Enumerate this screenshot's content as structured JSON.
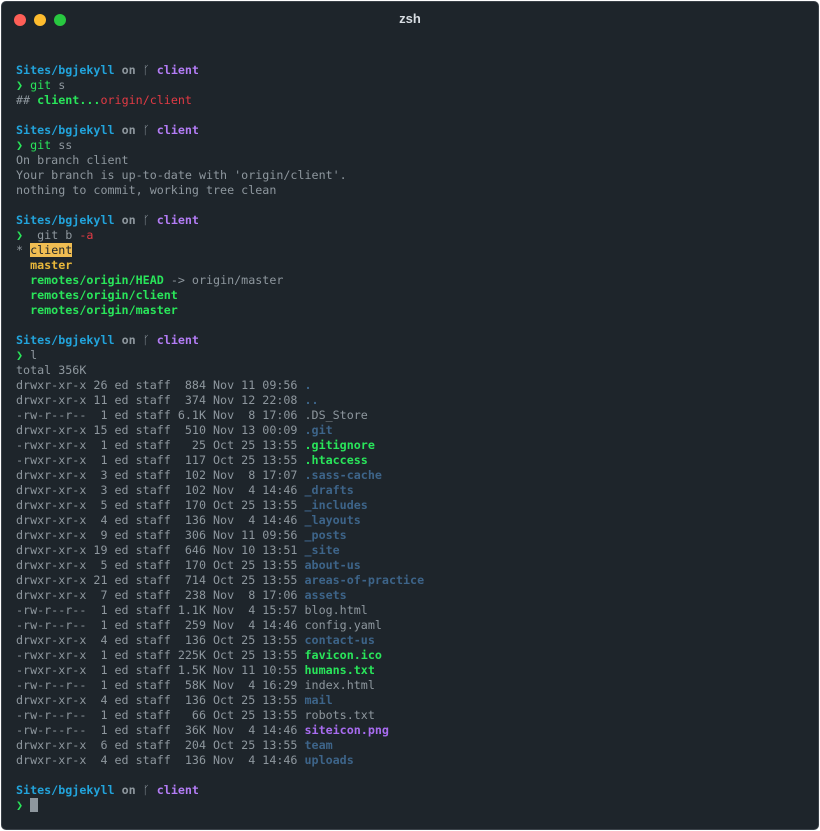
{
  "window": {
    "title": "zsh"
  },
  "prompt": {
    "dir": "Sites/bgjekyll",
    "on": "on",
    "branch": "client",
    "arrow": "❯",
    "branch_glyph": "ᚴ"
  },
  "blocks": [
    {
      "cmd": "git",
      "args": " s",
      "output": [
        {
          "pre": "## ",
          "a": "client...",
          "b": "origin/client"
        }
      ]
    },
    {
      "cmd": "git",
      "args": " ss",
      "output": [
        "On branch client",
        "Your branch is up-to-date with 'origin/client'.",
        "nothing to commit, working tree clean"
      ]
    },
    {
      "cmd": "git",
      "args": " b ",
      "flag": "-a",
      "branches": {
        "star": "* ",
        "current": "client",
        "master": "  master",
        "head": "  remotes/origin/HEAD",
        "head_target": " -> origin/master",
        "rclient": "  remotes/origin/client",
        "rmaster": "  remotes/origin/master"
      }
    },
    {
      "cmd": "l",
      "total": "total 356K"
    }
  ],
  "listing": [
    {
      "meta": "drwxr-xr-x 26 ed staff  884 Nov 11 09:56 ",
      "name": "."
    },
    {
      "meta": "drwxr-xr-x 11 ed staff  374 Nov 12 22:08 ",
      "name": ".."
    },
    {
      "meta": "-rw-r--r--  1 ed staff 6.1K Nov  8 17:06 ",
      "name": ".DS_Store"
    },
    {
      "meta": "drwxr-xr-x 15 ed staff  510 Nov 13 00:09 ",
      "name": ".git"
    },
    {
      "meta": "-rwxr-xr-x  1 ed staff   25 Oct 25 13:55 ",
      "name": ".gitignore"
    },
    {
      "meta": "-rwxr-xr-x  1 ed staff  117 Oct 25 13:55 ",
      "name": ".htaccess"
    },
    {
      "meta": "drwxr-xr-x  3 ed staff  102 Nov  8 17:07 ",
      "name": ".sass-cache"
    },
    {
      "meta": "drwxr-xr-x  3 ed staff  102 Nov  4 14:46 ",
      "name": "_drafts"
    },
    {
      "meta": "drwxr-xr-x  5 ed staff  170 Oct 25 13:55 ",
      "name": "_includes"
    },
    {
      "meta": "drwxr-xr-x  4 ed staff  136 Nov  4 14:46 ",
      "name": "_layouts"
    },
    {
      "meta": "drwxr-xr-x  9 ed staff  306 Nov 11 09:56 ",
      "name": "_posts"
    },
    {
      "meta": "drwxr-xr-x 19 ed staff  646 Nov 10 13:51 ",
      "name": "_site"
    },
    {
      "meta": "drwxr-xr-x  5 ed staff  170 Oct 25 13:55 ",
      "name": "about-us"
    },
    {
      "meta": "drwxr-xr-x 21 ed staff  714 Oct 25 13:55 ",
      "name": "areas-of-practice"
    },
    {
      "meta": "drwxr-xr-x  7 ed staff  238 Nov  8 17:06 ",
      "name": "assets"
    },
    {
      "meta": "-rw-r--r--  1 ed staff 1.1K Nov  4 15:57 ",
      "name": "blog.html"
    },
    {
      "meta": "-rw-r--r--  1 ed staff  259 Nov  4 14:46 ",
      "name": "config.yaml"
    },
    {
      "meta": "drwxr-xr-x  4 ed staff  136 Oct 25 13:55 ",
      "name": "contact-us"
    },
    {
      "meta": "-rwxr-xr-x  1 ed staff 225K Oct 25 13:55 ",
      "name": "favicon.ico"
    },
    {
      "meta": "-rwxr-xr-x  1 ed staff 1.5K Nov 11 10:55 ",
      "name": "humans.txt"
    },
    {
      "meta": "-rw-r--r--  1 ed staff  58K Nov  4 16:29 ",
      "name": "index.html"
    },
    {
      "meta": "drwxr-xr-x  4 ed staff  136 Oct 25 13:55 ",
      "name": "mail"
    },
    {
      "meta": "-rw-r--r--  1 ed staff   66 Oct 25 13:55 ",
      "name": "robots.txt"
    },
    {
      "meta": "-rw-r--r--  1 ed staff  36K Nov  4 14:46 ",
      "name": "siteicon.png"
    },
    {
      "meta": "drwxr-xr-x  6 ed staff  204 Oct 25 13:55 ",
      "name": "team"
    },
    {
      "meta": "drwxr-xr-x  4 ed staff  136 Nov  4 14:46 ",
      "name": "uploads"
    }
  ],
  "colors": {
    "background": "#1e252b",
    "prompt_dir": "#22a4dc",
    "prompt_branch": "#b37cf5",
    "arrow": "#29e55a",
    "directory": "#3d6489",
    "executable": "#29e55a",
    "image": "#a86cf0",
    "current_branch_highlight": "#f0bd52"
  }
}
